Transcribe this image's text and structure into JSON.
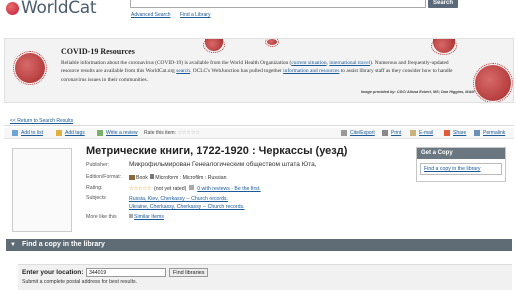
{
  "header": {
    "logo_text": "WorldCat",
    "search_button": "Search",
    "advanced_search": "Advanced Search",
    "find_library": "Find a Library"
  },
  "covid": {
    "title": "COVID-19 Resources",
    "text_1": "Reliable information about the coronavirus (COVID-19) is available from the World Health Organization (",
    "link_current": "current situation",
    "text_2": ", ",
    "link_travel": "international travel",
    "text_3": "). Numerous and frequently-updated resource results are available from this WorldCat.org ",
    "link_search": "search",
    "text_4": ". OCLC's WebJunction has pulled together ",
    "link_resources": "information and resources",
    "text_5": " to assist library staff as they consider how to handle coronavirus issues in their communities.",
    "credit": "Image provided by: CDC/ Alissa Eckert, MS; Dan Higgins, MAM"
  },
  "nav": {
    "return_link": "<< Return to Search Results"
  },
  "tools": {
    "add_list": "Add to list",
    "add_tags": "Add tags",
    "write_review": "Write a review",
    "rate_label": "Rate this item:",
    "stars": "☆☆☆☆☆",
    "cite": "Cite/Export",
    "print": "Print",
    "email": "E-mail",
    "share": "Share",
    "permalink": "Permalink"
  },
  "record": {
    "title": "Метрические книги, 1722-1920 : Черкассы (уезд)",
    "publisher_label": "Publisher:",
    "publisher_value": "Микрофильмирован Генеалогическим обществом штата Юта,",
    "edition_label": "Edition/Format:",
    "edition_book": "Book",
    "edition_rest": "Microform : Microfilm : Russian",
    "rating_label": "Rating:",
    "rating_stars": "☆☆☆☆☆",
    "rating_note": "(not yet rated)",
    "reviews_link": "0 with reviews - Be the first.",
    "subjects_label": "Subjects",
    "subject_1": "Russia, Kiev, Cherkassy -- Church records.",
    "subject_2": "Ukraine, Cherkassy, Cherkassy -- Church records.",
    "more_label": "More like this",
    "similar_items": "Similar Items"
  },
  "get_copy": {
    "heading": "Get a Copy",
    "link": "Find a copy in the library"
  },
  "find_copy": {
    "heading": "Find a copy in the library",
    "location_label": "Enter your location:",
    "location_value": "344019",
    "find_button": "Find libraries",
    "hint": "Submit a complete postal address for best results."
  }
}
